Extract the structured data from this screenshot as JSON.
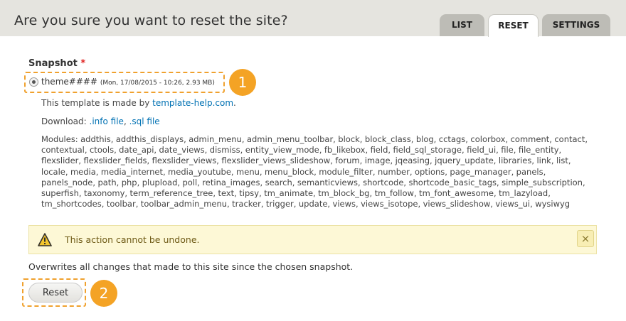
{
  "header": {
    "title": "Are you sure you want to reset the site?",
    "tabs": [
      {
        "label": "LIST",
        "active": false
      },
      {
        "label": "RESET",
        "active": true
      },
      {
        "label": "SETTINGS",
        "active": false
      }
    ]
  },
  "form": {
    "snapshot_label": "Snapshot",
    "required_mark": "*",
    "snapshot_option": {
      "name": "theme####",
      "meta": "(Mon, 17/08/2015 - 10:26, 2.93 MB)",
      "selected": true
    },
    "template_prefix": "This template is made by ",
    "template_link": "template-help.com",
    "template_suffix": ".",
    "download_prefix": "Download: ",
    "download_info": ".info file",
    "download_sep": ", ",
    "download_sql": ".sql file",
    "modules": "Modules: addthis, addthis_displays, admin_menu, admin_menu_toolbar, block, block_class, blog, cctags, colorbox, comment, contact, contextual, ctools, date_api, date_views, dismiss, entity_view_mode, fb_likebox, field, field_sql_storage, field_ui, file, file_entity, flexslider, flexslider_fields, flexslider_views, flexslider_views_slideshow, forum, image, jqeasing, jquery_update, libraries, link, list, locale, media, media_internet, media_youtube, menu, menu_block, module_filter, number, options, page_manager, panels, panels_node, path, php, plupload, poll, retina_images, search, semanticviews, shortcode, shortcode_basic_tags, simple_subscription, superfish, taxonomy, term_reference_tree, text, tipsy, tm_animate, tm_block_bg, tm_follow, tm_font_awesome, tm_lazyload, tm_shortcodes, toolbar, toolbar_admin_menu, tracker, trigger, update, views, views_isotope, views_slideshow, views_ui, wysiwyg",
    "warning_text": "This action cannot be undone.",
    "close_symbol": "×",
    "overwrite_text": "Overwrites all changes that made to this site since the chosen snapshot.",
    "reset_label": "Reset"
  },
  "annotations": {
    "badge_1": "1",
    "badge_2": "2"
  },
  "colors": {
    "accent_orange": "#f4a325",
    "link_blue": "#0071b3",
    "warning_bg": "#fdf8d6",
    "header_bg": "#e5e4df"
  },
  "icons": {
    "warning": "warning-triangle-icon",
    "close": "close-icon"
  }
}
